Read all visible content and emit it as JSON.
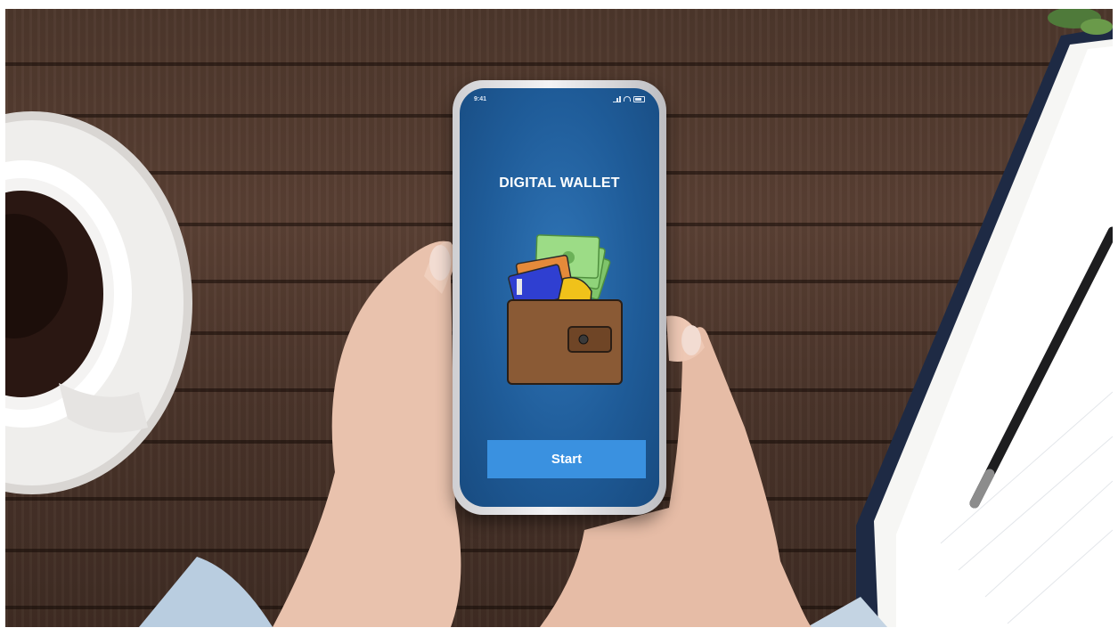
{
  "app": {
    "title": "DIGITAL WALLET",
    "start_label": "Start"
  },
  "status_bar": {
    "time": "9:41"
  },
  "icons": [
    "signal-icon",
    "wifi-icon",
    "battery-icon",
    "wallet-icon",
    "credit-card-icon",
    "banknotes-icon"
  ],
  "colors": {
    "screen_blue": "#1f5c99",
    "button_blue": "#3a91e0",
    "wallet_brown": "#8a5a35",
    "table_wood": "#4d372c"
  }
}
